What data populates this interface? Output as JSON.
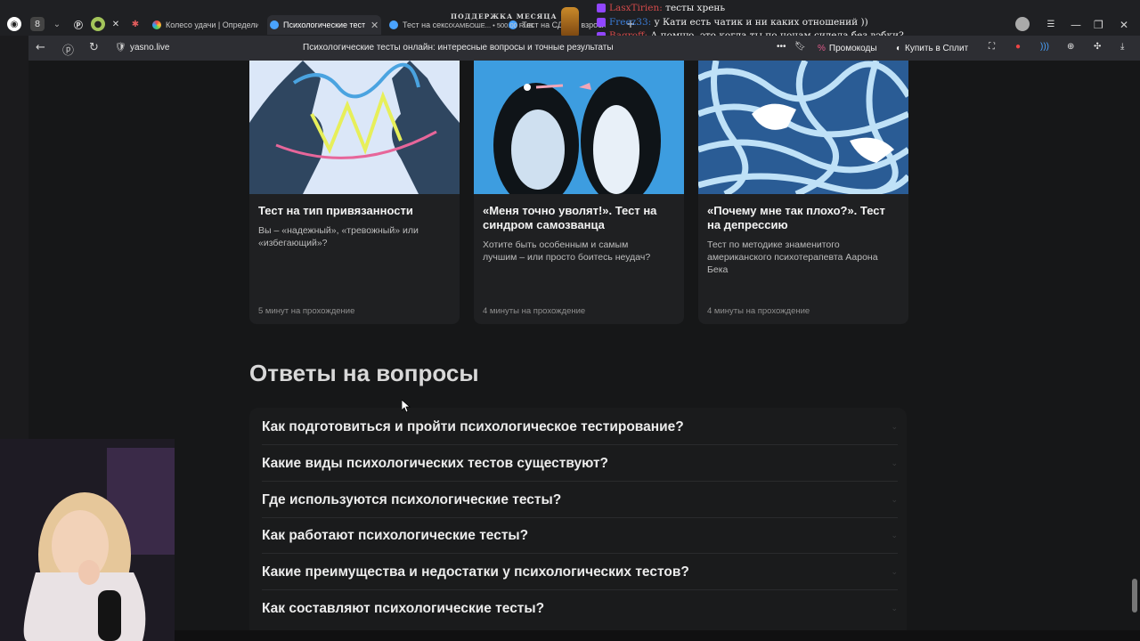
{
  "browser": {
    "tabs": [
      {
        "label": "Колесо удачи | Определи",
        "active": false
      },
      {
        "label": "Психологические тест",
        "active": true
      },
      {
        "label": "Тест на сексо",
        "active": false
      },
      {
        "label": "Тест на СДВГ у взрослых",
        "active": false
      }
    ],
    "url": "yasno.live",
    "page_title": "Психологические тесты онлайн: интересные вопросы и точные результаты",
    "promo_label": "Промокоды",
    "split_label": "Купить в Сплит"
  },
  "stream_overlay": {
    "support_title": "ПОДДЕРЖКА МЕСЯЦА ♡",
    "support_sub": "ХАМБОШЕ... • 500.00 RUB",
    "chat": [
      {
        "user": "LasxTirien:",
        "message": "тесты хрень",
        "color": "#d24a4a"
      },
      {
        "user": "Freez33:",
        "message": "у Кати есть чатик и ни каких отношений ))",
        "color": "#3a7bd5"
      },
      {
        "user": "Bagroff:",
        "message": "А помню, это когда ты по ночам сидела без вэбки?",
        "color": "#d24a4a"
      }
    ]
  },
  "cards": [
    {
      "title": "Тест на тип привязанности",
      "desc": "Вы – «надежный», «тревожный» или «избегающий»?",
      "time": "5 минут на прохождение",
      "image": "hands-icon"
    },
    {
      "title": "«Меня точно уволят!». Тест на синдром самозванца",
      "desc": "Хотите быть особенным и самым лучшим – или просто боитесь неудач?",
      "time": "4 минуты на прохождение",
      "image": "penguins-icon"
    },
    {
      "title": "«Почему мне так плохо?». Тест на депрессию",
      "desc": "Тест по методике знаменитого американского психотерапевта Аарона Бека",
      "time": "4 минуты на прохождение",
      "image": "tangle-icon"
    }
  ],
  "faq": {
    "title": "Ответы на вопросы",
    "items": [
      "Как подготовиться и пройти психологическое тестирование?",
      "Какие виды психологических тестов существуют?",
      "Где используются психологические тесты?",
      "Как работают психологические тесты?",
      "Какие преимущества и недостатки у психологических тестов?",
      "Как составляют психологические тесты?"
    ]
  }
}
